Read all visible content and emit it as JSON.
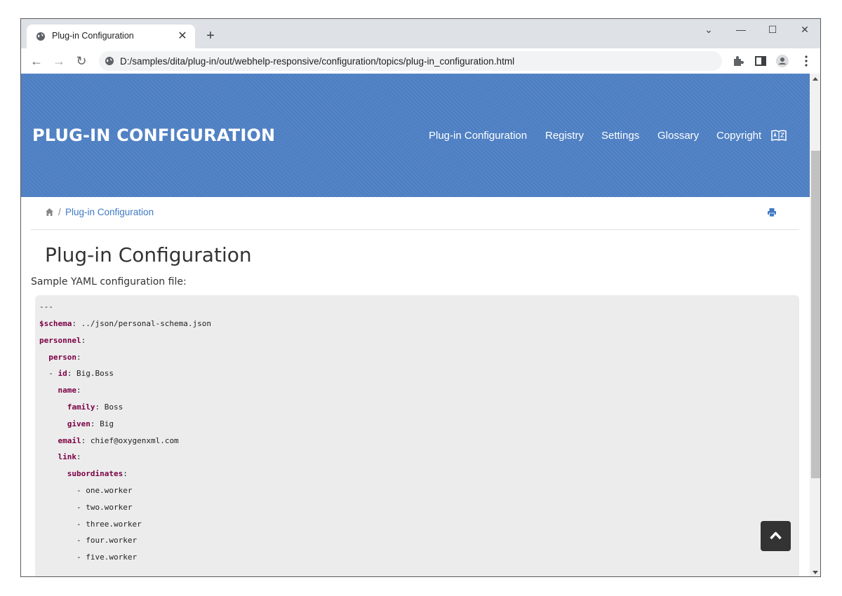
{
  "browser": {
    "tab_title": "Plug-in Configuration",
    "close_glyph": "✕",
    "new_tab_glyph": "+",
    "url": "D:/samples/dita/plug-in/out/webhelp-responsive/configuration/topics/plug-in_configuration.html",
    "window_controls": {
      "dropdown": "⌄",
      "minimize": "—",
      "maximize": "☐",
      "close": "✕"
    },
    "nav": {
      "back": "←",
      "forward": "→",
      "reload": "↻"
    }
  },
  "header": {
    "brand": "PLUG-IN CONFIGURATION",
    "menu": [
      "Plug-in Configuration",
      "Registry",
      "Settings",
      "Glossary",
      "Copyright"
    ],
    "background_color": "#4f81c5"
  },
  "breadcrumb": {
    "sep": "/",
    "link": "Plug-in Configuration"
  },
  "content": {
    "title": "Plug-in Configuration",
    "intro": "Sample YAML configuration file:"
  },
  "code": {
    "lines": [
      {
        "key": "",
        "text": "---"
      },
      {
        "key": "$schema",
        "text": ": ../json/personal-schema.json"
      },
      {
        "key": "personnel",
        "text": ":"
      },
      {
        "key": "  person",
        "text": ":"
      },
      {
        "key": "",
        "text": "  - "
      },
      {
        "key": "id",
        "text": ": Big.Boss"
      },
      {
        "key": "    name",
        "text": ":"
      },
      {
        "key": "      family",
        "text": ": Boss"
      },
      {
        "key": "      given",
        "text": ": Big"
      },
      {
        "key": "    email",
        "text": ": chief@oxygenxml.com"
      },
      {
        "key": "    link",
        "text": ":"
      },
      {
        "key": "      subordinates",
        "text": ":"
      },
      {
        "key": "",
        "text": "        - one.worker"
      },
      {
        "key": "",
        "text": "        - two.worker"
      },
      {
        "key": "",
        "text": "        - three.worker"
      },
      {
        "key": "",
        "text": "        - four.worker"
      },
      {
        "key": "",
        "text": "        - five.worker"
      }
    ]
  },
  "icons": {
    "tab_favicon": "globe-icon",
    "site_info": "globe-icon",
    "extensions": "puzzle-icon",
    "side_panel": "side-panel-icon",
    "profile": "profile-icon",
    "menu": "kebab-menu-icon",
    "dictionary": "dictionary-icon",
    "home": "home-icon",
    "print": "print-icon",
    "back_to_top": "chevron-up-icon"
  }
}
